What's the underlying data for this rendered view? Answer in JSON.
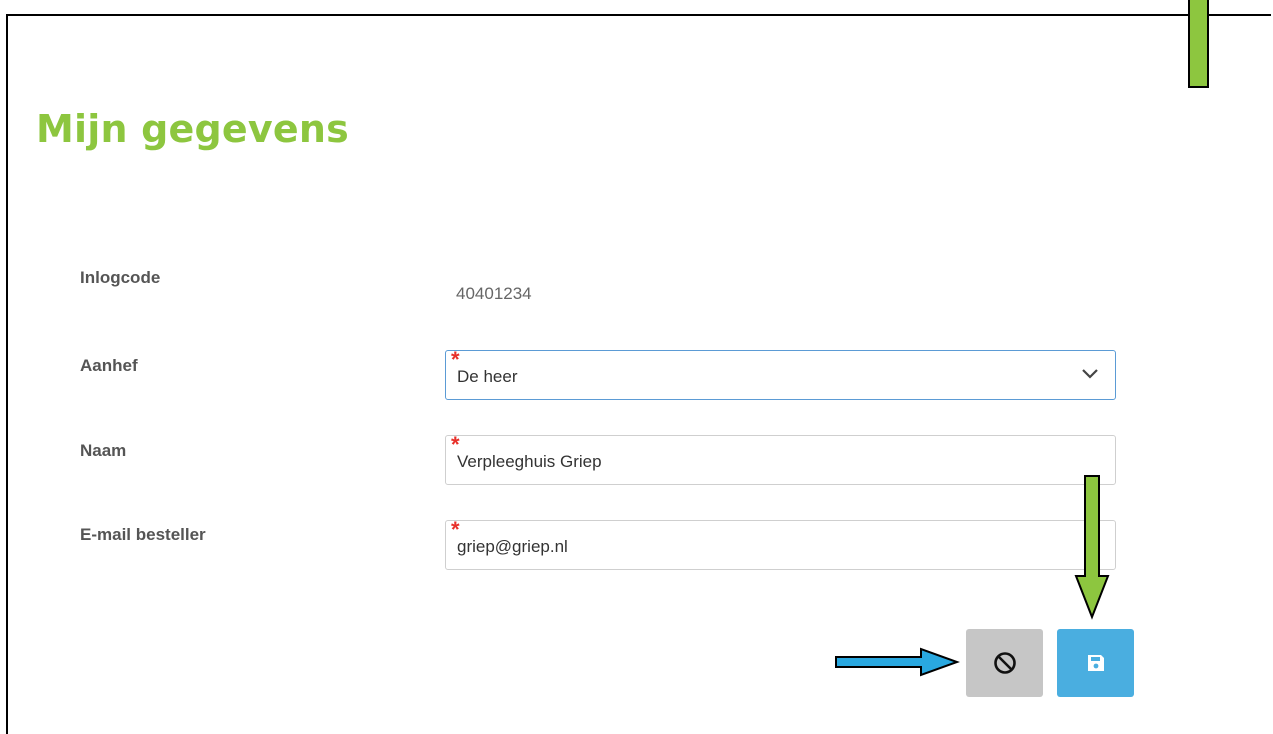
{
  "page": {
    "title": "Mijn gegevens"
  },
  "form": {
    "login_code_label": "Inlogcode",
    "login_code_value": "40401234",
    "salutation_label": "Aanhef",
    "salutation_value": "De heer",
    "name_label": "Naam",
    "name_value": "Verpleeghuis Griep",
    "email_label": "E-mail besteller",
    "email_value": "griep@griep.nl",
    "required_marker": "*"
  },
  "buttons": {
    "cancel_icon": "ban-icon",
    "save_icon": "floppy-disk-icon"
  },
  "colors": {
    "title": "#8dc63f",
    "required": "#e8302a",
    "save_button": "#4aaee0",
    "cancel_button": "#c6c6c6",
    "arrow_green": "#8dc63f",
    "arrow_blue": "#29a8e0"
  }
}
